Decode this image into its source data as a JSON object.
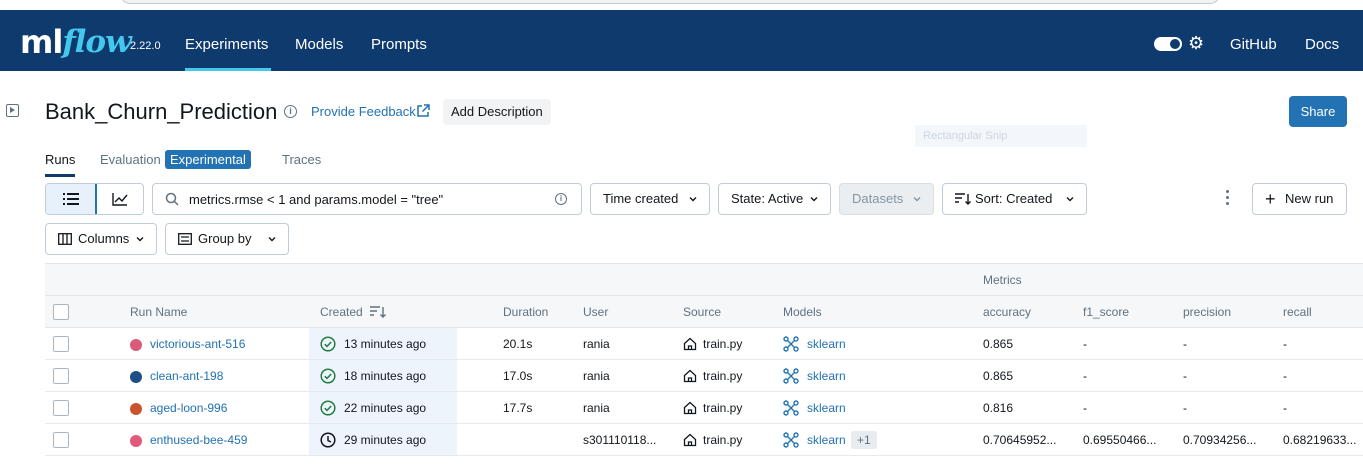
{
  "header": {
    "logo_ml": "ml",
    "logo_flow": "flow",
    "version": "2.22.0",
    "nav": [
      "Experiments",
      "Models",
      "Prompts"
    ],
    "right_links": [
      "GitHub",
      "Docs"
    ]
  },
  "experiment": {
    "title": "Bank_Churn_Prediction",
    "feedback_link": "Provide Feedback",
    "add_description": "Add Description",
    "share": "Share",
    "snip_ghost": "Rectangular Snip"
  },
  "tabs": {
    "runs": "Runs",
    "evaluation": "Evaluation",
    "experimental_badge": "Experimental",
    "traces": "Traces"
  },
  "toolbar": {
    "search_value": "metrics.rmse < 1 and params.model = \"tree\"",
    "time_created": "Time created",
    "state": "State: Active",
    "datasets": "Datasets",
    "sort": "Sort: Created",
    "new_run": "New run",
    "columns": "Columns",
    "group_by": "Group by"
  },
  "table": {
    "metrics_group": "Metrics",
    "headers": {
      "run_name": "Run Name",
      "created": "Created",
      "duration": "Duration",
      "user": "User",
      "source": "Source",
      "models": "Models",
      "accuracy": "accuracy",
      "f1_score": "f1_score",
      "precision": "precision",
      "recall": "recall"
    },
    "rows": [
      {
        "name": "victorious-ant-516",
        "color": "#d95b7a",
        "status": "finished",
        "created": "13 minutes ago",
        "duration": "20.1s",
        "user": "rania",
        "source": "train.py",
        "model": "sklearn",
        "extra": "",
        "accuracy": "0.865",
        "f1_score": "-",
        "precision": "-",
        "recall": "-"
      },
      {
        "name": "clean-ant-198",
        "color": "#1d4f86",
        "status": "finished",
        "created": "18 minutes ago",
        "duration": "17.0s",
        "user": "rania",
        "source": "train.py",
        "model": "sklearn",
        "extra": "",
        "accuracy": "0.865",
        "f1_score": "-",
        "precision": "-",
        "recall": "-"
      },
      {
        "name": "aged-loon-996",
        "color": "#c9542c",
        "status": "finished",
        "created": "22 minutes ago",
        "duration": "17.7s",
        "user": "rania",
        "source": "train.py",
        "model": "sklearn",
        "extra": "",
        "accuracy": "0.816",
        "f1_score": "-",
        "precision": "-",
        "recall": "-"
      },
      {
        "name": "enthused-bee-459",
        "color": "#e2597a",
        "status": "running",
        "created": "29 minutes ago",
        "duration": "",
        "user": "s301110118...",
        "source": "train.py",
        "model": "sklearn",
        "extra": "+1",
        "accuracy": "0.70645952...",
        "f1_score": "0.69550466...",
        "precision": "0.70934256...",
        "recall": "0.68219633..."
      }
    ]
  },
  "colors": {
    "header_bg": "#0e3a6e",
    "accent": "#43c9ed",
    "link": "#2272b4",
    "success": "#277c43"
  }
}
